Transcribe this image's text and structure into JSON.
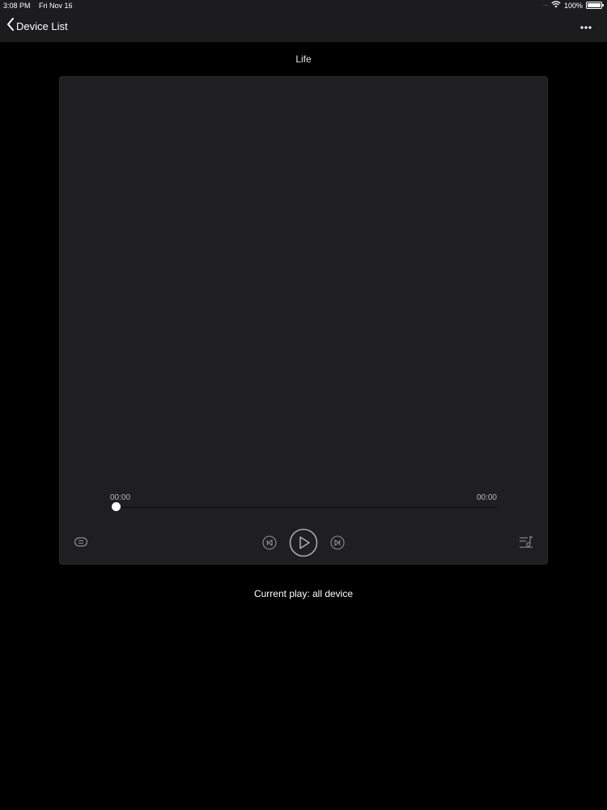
{
  "status_bar": {
    "time": "3:08 PM",
    "date": "Fri Nov 16",
    "signal_dots": "····",
    "battery": "100%"
  },
  "nav": {
    "back_label": "Device List",
    "back_icon": "chevron-left-icon",
    "more_icon": "ellipsis-icon"
  },
  "player": {
    "song_title": "Life",
    "elapsed": "00:00",
    "total": "00:00",
    "progress": 0,
    "controls": {
      "repeat_icon": "repeat-icon",
      "previous_icon": "previous-track-icon",
      "play_icon": "play-icon",
      "next_icon": "next-track-icon",
      "playlist_icon": "playlist-icon"
    }
  },
  "footer": {
    "current_play": "Current play: all device"
  },
  "colors": {
    "background": "#000000",
    "nav_bar": "#1c1c1e",
    "card": "#1f1f21",
    "icon": "#8e8e93"
  }
}
